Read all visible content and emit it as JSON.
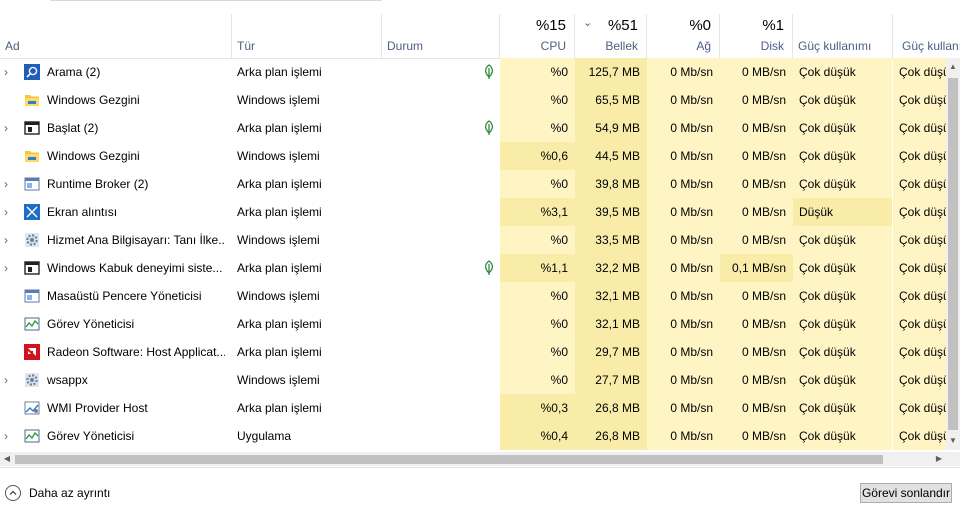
{
  "columns": {
    "name": "Ad",
    "type": "Tür",
    "status": "Durum",
    "cpu": {
      "pct": "%15",
      "label": "CPU"
    },
    "memory": {
      "pct": "%51",
      "label": "Bellek"
    },
    "network": {
      "pct": "%0",
      "label": "Ağ"
    },
    "disk": {
      "pct": "%1",
      "label": "Disk"
    },
    "power": "Güç kullanımı",
    "power_trend": "Güç kullanı"
  },
  "rows": [
    {
      "expand": true,
      "icon": "search-icon",
      "name": "Arama (2)",
      "type": "Arka plan işlemi",
      "leaf": true,
      "cpu": "%0",
      "mem": "125,7 MB",
      "net": "0 Mb/sn",
      "disk": "0 MB/sn",
      "power": "Çok düşük",
      "power_trend": "Çok düşük"
    },
    {
      "expand": false,
      "icon": "folder-icon",
      "name": "Windows Gezgini",
      "type": "Windows işlemi",
      "leaf": false,
      "cpu": "%0",
      "mem": "65,5 MB",
      "net": "0 Mb/sn",
      "disk": "0 MB/sn",
      "power": "Çok düşük",
      "power_trend": "Çok düşük"
    },
    {
      "expand": true,
      "icon": "window-icon",
      "name": "Başlat (2)",
      "type": "Arka plan işlemi",
      "leaf": true,
      "cpu": "%0",
      "mem": "54,9 MB",
      "net": "0 Mb/sn",
      "disk": "0 MB/sn",
      "power": "Çok düşük",
      "power_trend": "Çok düşük"
    },
    {
      "expand": false,
      "icon": "folder-icon",
      "name": "Windows Gezgini",
      "type": "Windows işlemi",
      "leaf": false,
      "cpu": "%0,6",
      "mem": "44,5 MB",
      "net": "0 Mb/sn",
      "disk": "0 MB/sn",
      "power": "Çok düşük",
      "power_trend": "Çok düşük"
    },
    {
      "expand": true,
      "icon": "app-icon",
      "name": "Runtime Broker (2)",
      "type": "Arka plan işlemi",
      "leaf": false,
      "cpu": "%0",
      "mem": "39,8 MB",
      "net": "0 Mb/sn",
      "disk": "0 MB/sn",
      "power": "Çok düşük",
      "power_trend": "Çok düşük"
    },
    {
      "expand": true,
      "icon": "snip-icon",
      "name": "Ekran alıntısı",
      "type": "Arka plan işlemi",
      "leaf": false,
      "cpu": "%3,1",
      "mem": "39,5 MB",
      "net": "0 Mb/sn",
      "disk": "0 MB/sn",
      "power": "Düşük",
      "power_trend": "Çok düşük"
    },
    {
      "expand": true,
      "icon": "gear-icon",
      "name": "Hizmet Ana Bilgisayarı: Tanı İlke...",
      "type": "Windows işlemi",
      "leaf": false,
      "cpu": "%0",
      "mem": "33,5 MB",
      "net": "0 Mb/sn",
      "disk": "0 MB/sn",
      "power": "Çok düşük",
      "power_trend": "Çok düşük"
    },
    {
      "expand": true,
      "icon": "window-icon",
      "name": "Windows Kabuk deneyimi siste...",
      "type": "Arka plan işlemi",
      "leaf": true,
      "cpu": "%1,1",
      "mem": "32,2 MB",
      "net": "0 Mb/sn",
      "disk": "0,1 MB/sn",
      "power": "Çok düşük",
      "power_trend": "Çok düşük"
    },
    {
      "expand": false,
      "icon": "app-icon",
      "name": "Masaüstü Pencere Yöneticisi",
      "type": "Windows işlemi",
      "leaf": false,
      "cpu": "%0",
      "mem": "32,1 MB",
      "net": "0 Mb/sn",
      "disk": "0 MB/sn",
      "power": "Çok düşük",
      "power_trend": "Çok düşük"
    },
    {
      "expand": false,
      "icon": "taskmgr-icon",
      "name": "Görev Yöneticisi",
      "type": "Arka plan işlemi",
      "leaf": false,
      "cpu": "%0",
      "mem": "32,1 MB",
      "net": "0 Mb/sn",
      "disk": "0 MB/sn",
      "power": "Çok düşük",
      "power_trend": "Çok düşük"
    },
    {
      "expand": false,
      "icon": "amd-icon",
      "name": "Radeon Software: Host Applicat...",
      "type": "Arka plan işlemi",
      "leaf": false,
      "cpu": "%0",
      "mem": "29,7 MB",
      "net": "0 Mb/sn",
      "disk": "0 MB/sn",
      "power": "Çok düşük",
      "power_trend": "Çok düşük"
    },
    {
      "expand": true,
      "icon": "gear-icon",
      "name": "wsappx",
      "type": "Windows işlemi",
      "leaf": false,
      "cpu": "%0",
      "mem": "27,7 MB",
      "net": "0 Mb/sn",
      "disk": "0 MB/sn",
      "power": "Çok düşük",
      "power_trend": "Çok düşük"
    },
    {
      "expand": false,
      "icon": "wmi-icon",
      "name": "WMI Provider Host",
      "type": "Arka plan işlemi",
      "leaf": false,
      "cpu": "%0,3",
      "mem": "26,8 MB",
      "net": "0 Mb/sn",
      "disk": "0 MB/sn",
      "power": "Çok düşük",
      "power_trend": "Çok düşük"
    },
    {
      "expand": true,
      "icon": "taskmgr-icon",
      "name": "Görev Yöneticisi",
      "type": "Uygulama",
      "leaf": false,
      "cpu": "%0,4",
      "mem": "26,8 MB",
      "net": "0 Mb/sn",
      "disk": "0 MB/sn",
      "power": "Çok düşük",
      "power_trend": "Çok düşük"
    }
  ],
  "footer": {
    "fewer_details": "Daha az ayrıntı",
    "end_task": "Görevi sonlandır"
  },
  "colors": {
    "heat_light": "#fff4c4",
    "heat_medium": "#f9eca8",
    "header_label": "#4d6082"
  }
}
